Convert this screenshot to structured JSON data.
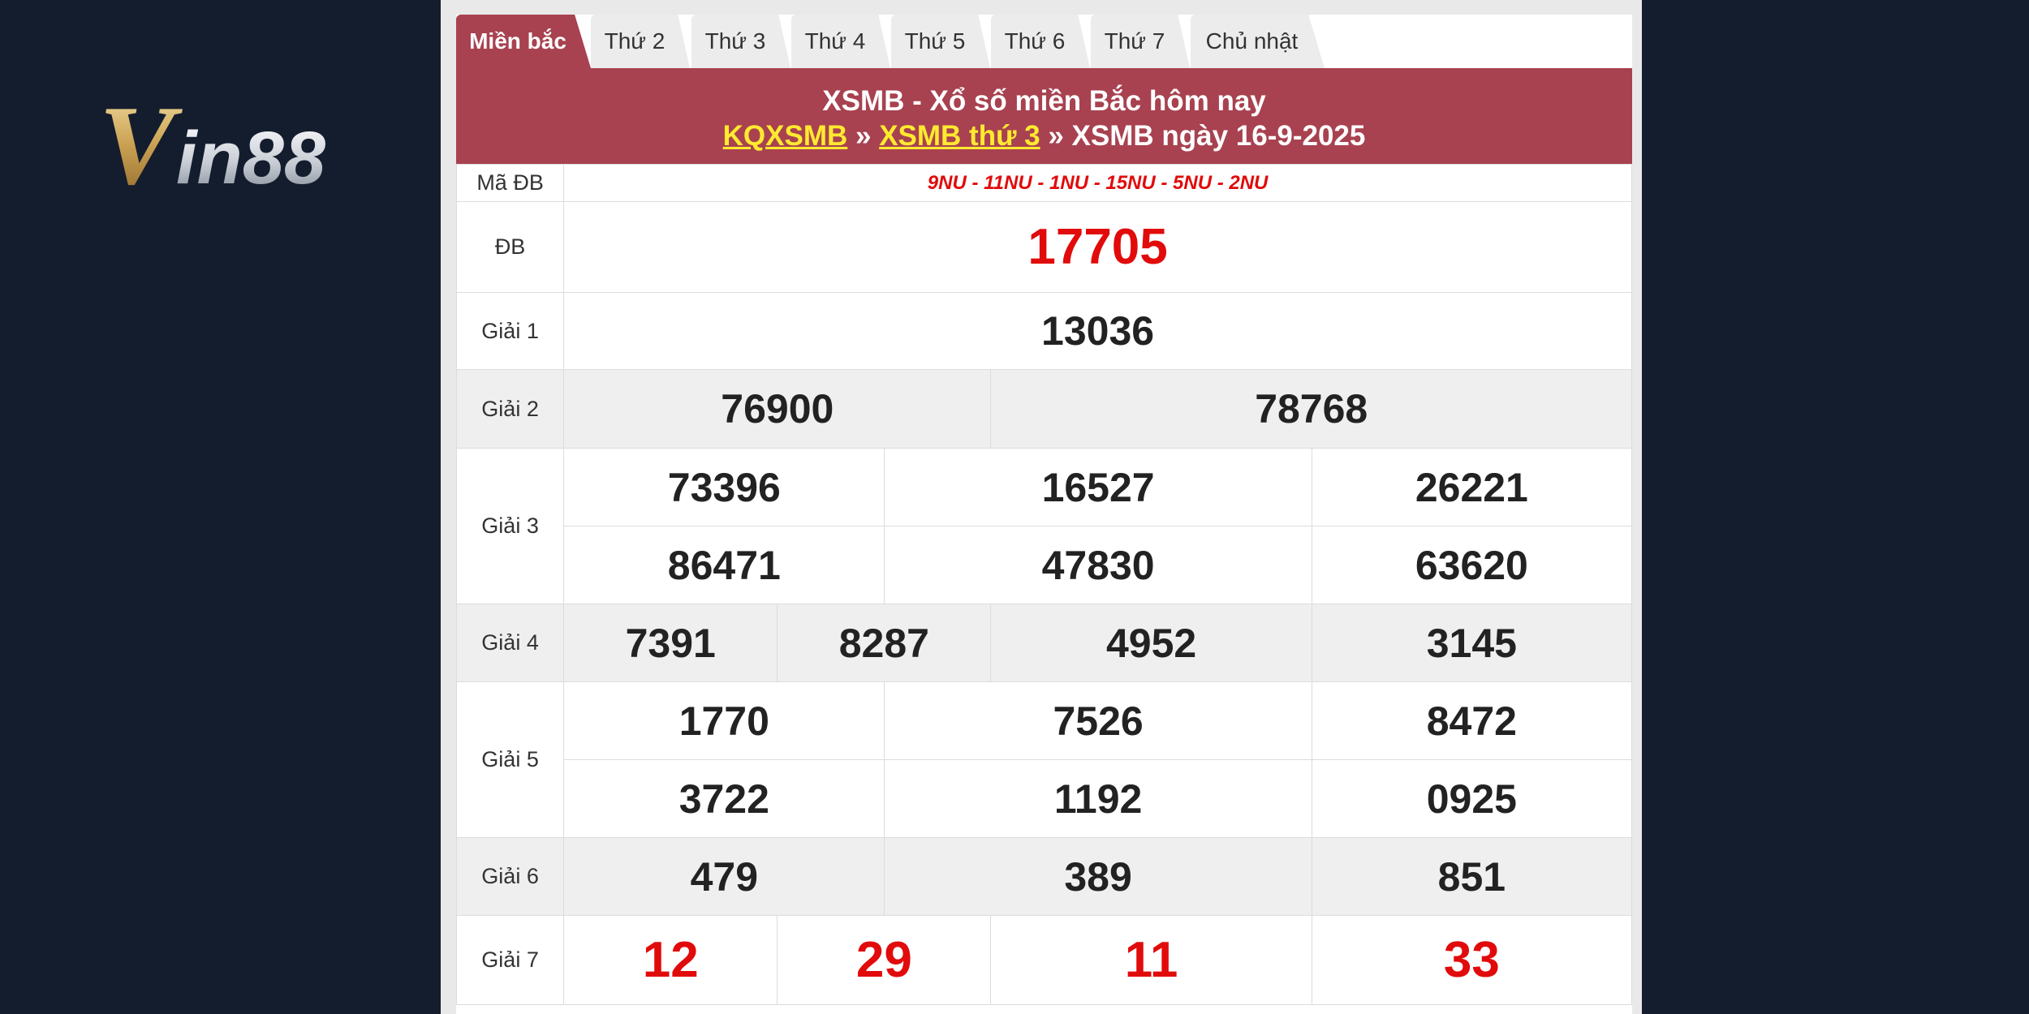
{
  "logo": {
    "text_v": "V",
    "text_rest": "in88"
  },
  "tabs": [
    {
      "label": "Miền bắc",
      "active": true
    },
    {
      "label": "Thứ 2"
    },
    {
      "label": "Thứ 3"
    },
    {
      "label": "Thứ 4"
    },
    {
      "label": "Thứ 5"
    },
    {
      "label": "Thứ 6"
    },
    {
      "label": "Thứ 7"
    },
    {
      "label": "Chủ nhật"
    }
  ],
  "header": {
    "title": "XSMB - Xổ số miền Bắc hôm nay",
    "link1": "KQXSMB",
    "sep1": " » ",
    "link2": "XSMB thứ 3",
    "sep2": " » ",
    "current": "XSMB ngày 16-9-2025"
  },
  "results": {
    "ma_db_label": "Mã ĐB",
    "ma_db_value": "9NU - 11NU - 1NU - 15NU - 5NU - 2NU",
    "db_label": "ĐB",
    "db": "17705",
    "g1_label": "Giải 1",
    "g1": "13036",
    "g2_label": "Giải 2",
    "g2": [
      "76900",
      "78768"
    ],
    "g3_label": "Giải 3",
    "g3": [
      "73396",
      "16527",
      "26221",
      "86471",
      "47830",
      "63620"
    ],
    "g4_label": "Giải 4",
    "g4": [
      "7391",
      "8287",
      "4952",
      "3145"
    ],
    "g5_label": "Giải 5",
    "g5": [
      "1770",
      "7526",
      "8472",
      "3722",
      "1192",
      "0925"
    ],
    "g6_label": "Giải 6",
    "g6": [
      "479",
      "389",
      "851"
    ],
    "g7_label": "Giải 7",
    "g7": [
      "12",
      "29",
      "11",
      "33"
    ]
  },
  "colors": {
    "background": "#141d2d",
    "header": "#a84250",
    "link": "#ffea2f",
    "highlight": "#e10b0b"
  }
}
